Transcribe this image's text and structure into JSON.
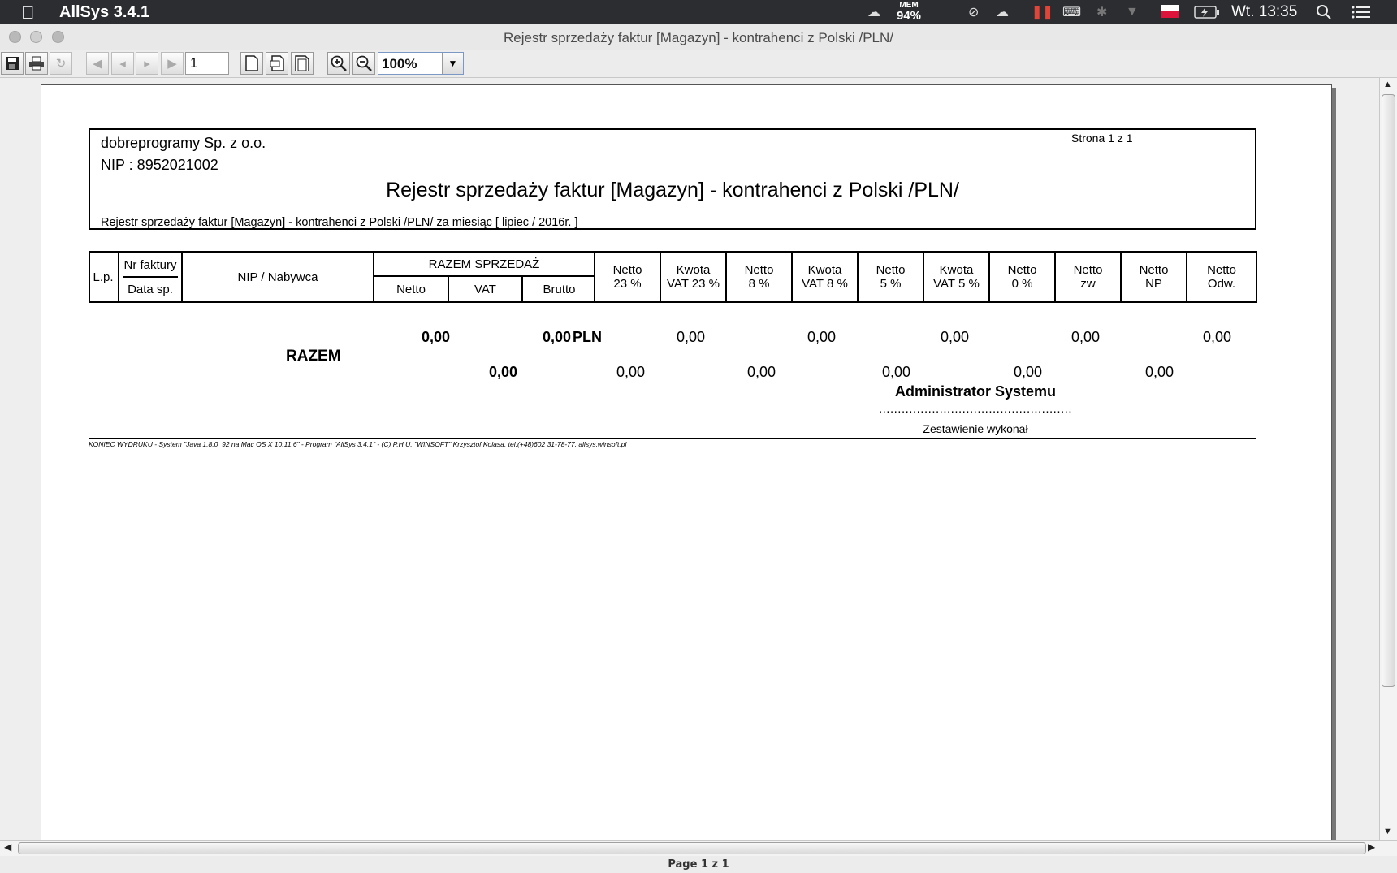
{
  "menubar": {
    "app_name": "AllSys 3.4.1",
    "mem_label": "MEM",
    "mem_value": "94%",
    "clock": "Wt. 13:35"
  },
  "window": {
    "title": "Rejestr sprzedaży faktur [Magazyn] - kontrahenci z Polski /PLN/"
  },
  "toolbar": {
    "page_number": "1",
    "zoom": "100%"
  },
  "report": {
    "company": "dobreprogramy Sp. z o.o.",
    "nip": "NIP : 8952021002",
    "page_info": "Strona 1 z 1",
    "title": "Rejestr sprzedaży faktur [Magazyn] - kontrahenci z Polski /PLN/",
    "subtitle": "Rejestr sprzedaży faktur [Magazyn] - kontrahenci z Polski /PLN/ za miesiąc [ lipiec / 2016r. ]",
    "columns": {
      "lp": "L.p.",
      "nr_faktury": "Nr faktury",
      "data_sp": "Data sp.",
      "nabywca": "NIP / Nabywca",
      "razem_sprzedaz": "RAZEM SPRZEDAŻ",
      "netto": "Netto",
      "vat": "VAT",
      "brutto": "Brutto",
      "netto_23_a": "Netto",
      "netto_23_b": "23 %",
      "kwota_23_a": "Kwota",
      "kwota_23_b": "VAT 23 %",
      "netto_8_a": "Netto",
      "netto_8_b": "8 %",
      "kwota_8_a": "Kwota",
      "kwota_8_b": "VAT 8 %",
      "netto_5_a": "Netto",
      "netto_5_b": "5 %",
      "kwota_5_a": "Kwota",
      "kwota_5_b": "VAT 5 %",
      "netto_0_a": "Netto",
      "netto_0_b": "0 %",
      "netto_zw_a": "Netto",
      "netto_zw_b": "zw",
      "netto_np_a": "Netto",
      "netto_np_b": "NP",
      "netto_odw_a": "Netto",
      "netto_odw_b": "Odw."
    },
    "totals": {
      "label": "RAZEM",
      "netto": "0,00",
      "brutto": "0,00",
      "currency": "PLN",
      "vat": "0,00",
      "netto_23": "0,00",
      "kwota_23": "0,00",
      "netto_8": "0,00",
      "kwota_8": "0,00",
      "netto_5": "0,00",
      "kwota_5": "0,00",
      "netto_0": "0,00",
      "netto_zw": "0,00",
      "netto_np": "0,00",
      "netto_odw": "0,00"
    },
    "signature_name": "Administrator Systemu",
    "signature_dots": "...................................................",
    "signature_label": "Zestawienie wykonał",
    "footer": "KONIEC WYDRUKU - System \"Java 1.8.0_92 na Mac OS X 10.11.6\" - Program \"AllSys 3.4.1\" - (C) P.H.U. \"WINSOFT\" Krzysztof Kolasa, tel.(+48)602 31-78-77, allsys.winsoft.pl"
  },
  "status": {
    "page_label": "Page 1 z 1"
  }
}
